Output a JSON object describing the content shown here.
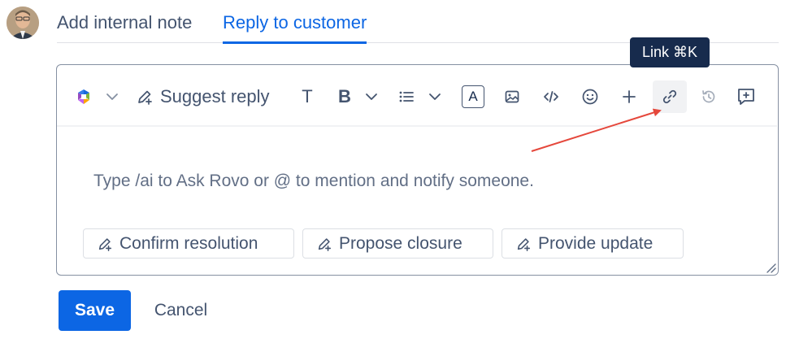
{
  "tabs": {
    "internal_note": "Add internal note",
    "reply_to_customer": "Reply to customer"
  },
  "tooltip": {
    "label": "Link ⌘K"
  },
  "toolbar": {
    "suggest_reply": "Suggest reply",
    "text_style_glyph": "T",
    "bold_glyph": "B",
    "text_color_glyph": "A"
  },
  "editor": {
    "placeholder": "Type /ai to Ask Rovo or @ to mention and notify someone."
  },
  "suggestions": [
    "Confirm resolution",
    "Propose closure",
    "Provide update"
  ],
  "actions": {
    "save": "Save",
    "cancel": "Cancel"
  },
  "colors": {
    "accent": "#0c66e4",
    "annotation_arrow": "#e5483c",
    "tooltip_bg": "#172b4d"
  },
  "icons": [
    "rovo-logo-icon",
    "chevron-down-icon",
    "ai-edit-icon",
    "bullet-list-icon",
    "image-icon",
    "code-icon",
    "emoji-icon",
    "plus-icon",
    "link-icon",
    "history-icon",
    "add-comment-icon",
    "resize-handle-icon"
  ]
}
